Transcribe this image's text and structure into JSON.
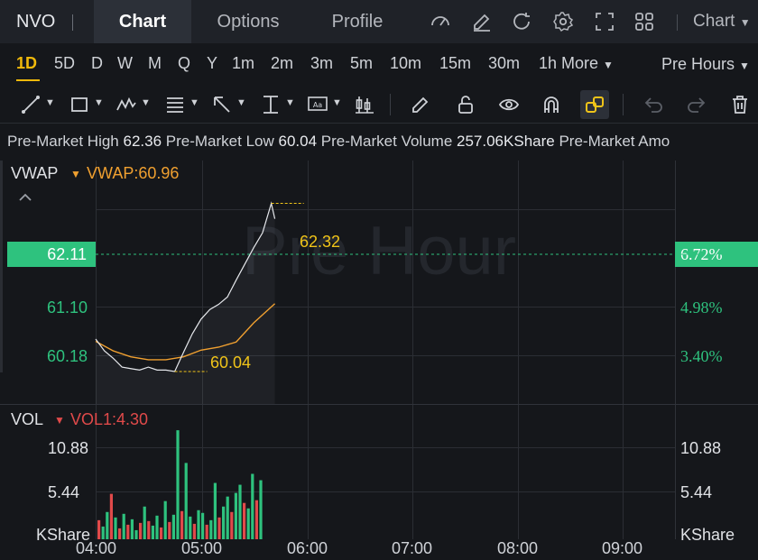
{
  "header": {
    "symbol": "NVO",
    "tabs": [
      "Chart",
      "Options",
      "Profile"
    ],
    "active_tab": "Chart",
    "chart_menu": "Chart",
    "icons": [
      "indicator-gauge-icon",
      "edit-icon",
      "refresh-icon",
      "settings-icon",
      "fullscreen-icon",
      "layout-grid-icon"
    ]
  },
  "timeframes": {
    "items": [
      "1D",
      "5D",
      "D",
      "W",
      "M",
      "Q",
      "Y",
      "1m",
      "2m",
      "3m",
      "5m",
      "10m",
      "15m",
      "30m",
      "1h"
    ],
    "selected": "1D",
    "more_label": "More",
    "session_label": "Pre Hours"
  },
  "toolbar": {
    "icons": [
      "trendline-icon",
      "rectangle-icon",
      "pattern-icon",
      "fib-icon",
      "arrow-icon",
      "measure-icon",
      "text-annotation-icon",
      "candle-icon",
      "brush-icon",
      "unlock-icon",
      "eye-icon",
      "magnet-icon",
      "link-icon",
      "undo-icon",
      "redo-icon",
      "trash-icon"
    ]
  },
  "info": {
    "high_label": "Pre-Market High",
    "high_value": "62.36",
    "low_label": "Pre-Market Low",
    "low_value": "60.04",
    "volume_label": "Pre-Market Volume",
    "volume_value": "257.06KShare",
    "amount_label": "Pre-Market Amo"
  },
  "price_pane": {
    "indicator": "VWAP",
    "indicator_value": "VWAP:60.96",
    "last_price": "62.11",
    "last_pct": "6.72%",
    "left_ticks": [
      "61.10",
      "60.18"
    ],
    "right_ticks": [
      "4.98%",
      "3.40%"
    ],
    "watermark": "Pre Hour",
    "high_marker": "62.32",
    "low_marker": "60.04"
  },
  "volume_pane": {
    "indicator": "VOL",
    "indicator_value": "VOL1:4.30",
    "left_ticks": [
      "10.88",
      "5.44"
    ],
    "right_ticks": [
      "10.88",
      "5.44"
    ],
    "unit": "KShare"
  },
  "x_axis": [
    "04:00",
    "05:00",
    "06:00",
    "07:00",
    "08:00",
    "09:00"
  ],
  "colors": {
    "up": "#2ec27e",
    "down": "#e04a4a",
    "vwap": "#f0a030",
    "marker": "#f0c419",
    "accent": "#f0b90b"
  },
  "chart_data": {
    "type": "line",
    "price_series": [
      {
        "x": "04:00",
        "y": 60.48
      },
      {
        "x": "04:05",
        "y": 60.32
      },
      {
        "x": "04:10",
        "y": 60.22
      },
      {
        "x": "04:15",
        "y": 60.1
      },
      {
        "x": "04:20",
        "y": 60.08
      },
      {
        "x": "04:25",
        "y": 60.06
      },
      {
        "x": "04:30",
        "y": 60.1
      },
      {
        "x": "04:35",
        "y": 60.06
      },
      {
        "x": "04:40",
        "y": 60.06
      },
      {
        "x": "04:45",
        "y": 60.04
      },
      {
        "x": "04:50",
        "y": 60.3
      },
      {
        "x": "04:55",
        "y": 60.55
      },
      {
        "x": "05:00",
        "y": 60.75
      },
      {
        "x": "05:05",
        "y": 60.88
      },
      {
        "x": "05:10",
        "y": 60.95
      },
      {
        "x": "05:15",
        "y": 61.05
      },
      {
        "x": "05:20",
        "y": 61.28
      },
      {
        "x": "05:25",
        "y": 61.5
      },
      {
        "x": "05:30",
        "y": 61.72
      },
      {
        "x": "05:35",
        "y": 61.92
      },
      {
        "x": "05:40",
        "y": 62.32
      },
      {
        "x": "05:42",
        "y": 62.11
      }
    ],
    "vwap_series": [
      {
        "x": "04:00",
        "y": 60.45
      },
      {
        "x": "04:10",
        "y": 60.32
      },
      {
        "x": "04:20",
        "y": 60.24
      },
      {
        "x": "04:30",
        "y": 60.2
      },
      {
        "x": "04:40",
        "y": 60.2
      },
      {
        "x": "04:50",
        "y": 60.24
      },
      {
        "x": "05:00",
        "y": 60.33
      },
      {
        "x": "05:10",
        "y": 60.37
      },
      {
        "x": "05:20",
        "y": 60.44
      },
      {
        "x": "05:30",
        "y": 60.7
      },
      {
        "x": "05:42",
        "y": 60.96
      }
    ],
    "volume_bars": [
      {
        "v": 2.1,
        "up": false
      },
      {
        "v": 1.4,
        "up": true
      },
      {
        "v": 3.0,
        "up": true
      },
      {
        "v": 5.0,
        "up": false
      },
      {
        "v": 2.4,
        "up": true
      },
      {
        "v": 1.2,
        "up": false
      },
      {
        "v": 2.8,
        "up": true
      },
      {
        "v": 1.6,
        "up": false
      },
      {
        "v": 2.2,
        "up": true
      },
      {
        "v": 1.0,
        "up": true
      },
      {
        "v": 1.8,
        "up": false
      },
      {
        "v": 3.6,
        "up": true
      },
      {
        "v": 2.0,
        "up": false
      },
      {
        "v": 1.5,
        "up": true
      },
      {
        "v": 2.6,
        "up": true
      },
      {
        "v": 1.3,
        "up": false
      },
      {
        "v": 4.2,
        "up": true
      },
      {
        "v": 1.9,
        "up": false
      },
      {
        "v": 2.7,
        "up": true
      },
      {
        "v": 12.0,
        "up": true
      },
      {
        "v": 3.1,
        "up": false
      },
      {
        "v": 8.4,
        "up": true
      },
      {
        "v": 2.5,
        "up": true
      },
      {
        "v": 1.7,
        "up": false
      },
      {
        "v": 3.2,
        "up": true
      },
      {
        "v": 2.9,
        "up": true
      },
      {
        "v": 1.6,
        "up": false
      },
      {
        "v": 2.1,
        "up": true
      },
      {
        "v": 6.2,
        "up": true
      },
      {
        "v": 2.4,
        "up": false
      },
      {
        "v": 3.6,
        "up": true
      },
      {
        "v": 4.7,
        "up": true
      },
      {
        "v": 3.0,
        "up": false
      },
      {
        "v": 5.1,
        "up": true
      },
      {
        "v": 6.0,
        "up": true
      },
      {
        "v": 4.0,
        "up": false
      },
      {
        "v": 3.4,
        "up": true
      },
      {
        "v": 7.2,
        "up": true
      },
      {
        "v": 4.3,
        "up": false
      },
      {
        "v": 6.5,
        "up": true
      }
    ],
    "xlim": [
      "04:00",
      "09:00"
    ],
    "ylim": [
      59.6,
      62.9
    ],
    "vol_ylim": [
      0,
      13.5
    ]
  }
}
